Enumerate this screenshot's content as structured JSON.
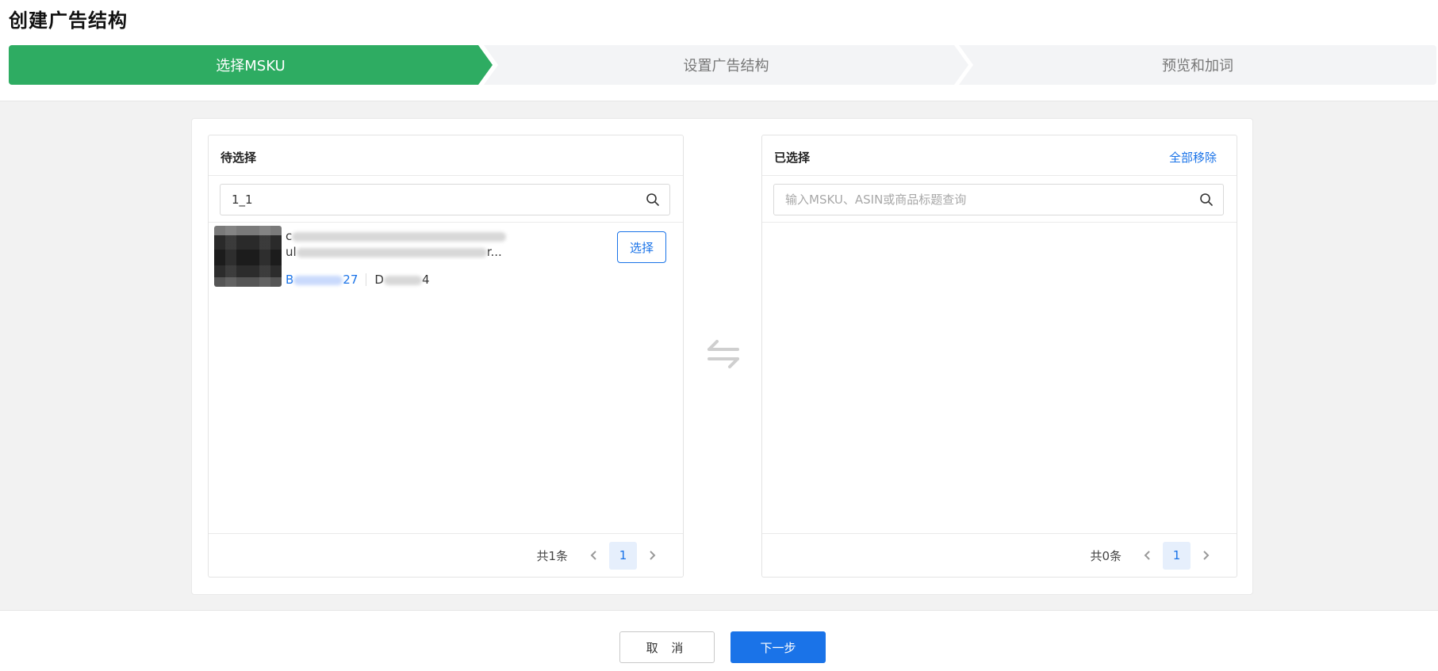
{
  "page": {
    "title": "创建广告结构"
  },
  "steps": [
    {
      "label": "选择MSKU",
      "state": "active"
    },
    {
      "label": "设置广告结构",
      "state": "pending"
    },
    {
      "label": "预览和加词",
      "state": "pending"
    }
  ],
  "left_panel": {
    "title": "待选择",
    "search_value": "1_1",
    "items": [
      {
        "title_line1": "c",
        "title_line2": "ul",
        "title_line2_end": "r...",
        "asin_start": "B",
        "asin_end": "27",
        "msku_start": "D",
        "msku_end": "4",
        "select_label": "选择"
      }
    ],
    "total": "共1条",
    "page": "1"
  },
  "right_panel": {
    "title": "已选择",
    "remove_all": "全部移除",
    "search_placeholder": "输入MSKU、ASIN或商品标题查询",
    "total": "共0条",
    "page": "1"
  },
  "footer": {
    "cancel": "取 消",
    "next": "下一步"
  },
  "colors": {
    "step_active": "#2eac62",
    "primary": "#1a73e8",
    "step_inactive": "#f3f4f6"
  }
}
